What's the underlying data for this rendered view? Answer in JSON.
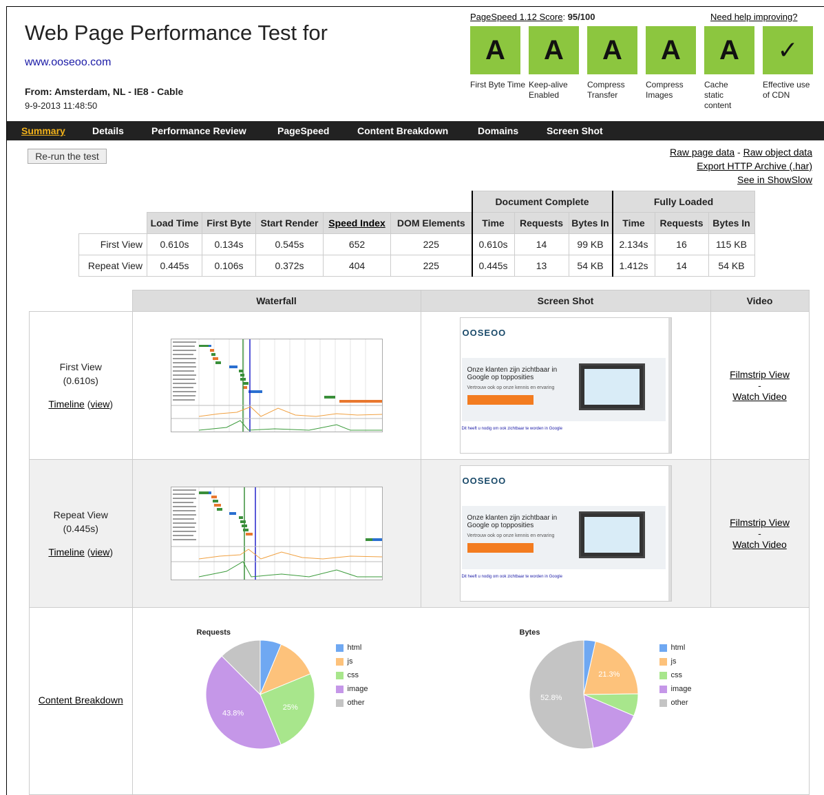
{
  "header": {
    "title": "Web Page Performance Test for",
    "url": "www.ooseoo.com",
    "from": "From: Amsterdam, NL - IE8 - Cable",
    "datetime": "9-9-2013 11:48:50",
    "pagespeed_label": "PageSpeed 1.12 Score",
    "pagespeed_score": "95/100",
    "help_link": "Need help improving?"
  },
  "grades": [
    {
      "grade": "A",
      "label": "First Byte Time"
    },
    {
      "grade": "A",
      "label": "Keep-alive Enabled"
    },
    {
      "grade": "A",
      "label": "Compress Transfer"
    },
    {
      "grade": "A",
      "label": "Compress Images"
    },
    {
      "grade": "A",
      "label": "Cache static content"
    },
    {
      "grade": "✓",
      "label": "Effective use of CDN"
    }
  ],
  "nav": [
    "Summary",
    "Details",
    "Performance Review",
    "PageSpeed",
    "Content Breakdown",
    "Domains",
    "Screen Shot"
  ],
  "actions": {
    "rerun": "Re-run the test",
    "raw_page": "Raw page data",
    "separator": "-",
    "raw_object": "Raw object data",
    "export_har": "Export HTTP Archive (.har)",
    "showslow": "See in ShowSlow"
  },
  "results": {
    "group_headers": [
      "Document Complete",
      "Fully Loaded"
    ],
    "columns": [
      "Load Time",
      "First Byte",
      "Start Render",
      "Speed Index",
      "DOM Elements",
      "Time",
      "Requests",
      "Bytes In",
      "Time",
      "Requests",
      "Bytes In"
    ],
    "rows": [
      {
        "label": "First View",
        "values": [
          "0.610s",
          "0.134s",
          "0.545s",
          "652",
          "225",
          "0.610s",
          "14",
          "99 KB",
          "2.134s",
          "16",
          "115 KB"
        ]
      },
      {
        "label": "Repeat View",
        "values": [
          "0.445s",
          "0.106s",
          "0.372s",
          "404",
          "225",
          "0.445s",
          "13",
          "54 KB",
          "1.412s",
          "14",
          "54 KB"
        ]
      }
    ]
  },
  "grid": {
    "headers": [
      "Waterfall",
      "Screen Shot",
      "Video"
    ],
    "views": [
      {
        "name": "First View",
        "time": "(0.610s)",
        "timeline": "Timeline",
        "view": "view",
        "filmstrip": "Filmstrip View",
        "dash": "-",
        "watch": "Watch Video"
      },
      {
        "name": "Repeat View",
        "time": "(0.445s)",
        "timeline": "Timeline",
        "view": "view",
        "filmstrip": "Filmstrip View",
        "dash": "-",
        "watch": "Watch Video"
      }
    ],
    "screenshot": {
      "logo": "OOSEOO",
      "headline": "Onze klanten zijn zichtbaar in Google op topposities",
      "sub": "Vertrouw ook op onze kennis en ervaring",
      "footer": "Dit heeft u nodig om ook zichtbaar te worden in Google"
    },
    "content_breakdown": "Content Breakdown"
  },
  "chart_data": [
    {
      "type": "pie",
      "title": "Requests",
      "categories": [
        "html",
        "js",
        "css",
        "image",
        "other"
      ],
      "values": [
        6.3,
        12.5,
        25,
        43.8,
        12.5
      ],
      "labels": [
        "",
        "",
        "25%",
        "43.8%",
        ""
      ],
      "colors": [
        "#6fa8f2",
        "#fdc27b",
        "#a8e68c",
        "#c597e8",
        "#c4c4c4"
      ]
    },
    {
      "type": "pie",
      "title": "Bytes",
      "categories": [
        "html",
        "js",
        "css",
        "image",
        "other"
      ],
      "values": [
        3.5,
        21.3,
        6.6,
        15.8,
        52.8
      ],
      "labels": [
        "",
        "21.3%",
        "",
        "",
        "52.8%"
      ],
      "colors": [
        "#6fa8f2",
        "#fdc27b",
        "#a8e68c",
        "#c597e8",
        "#c4c4c4"
      ]
    }
  ]
}
